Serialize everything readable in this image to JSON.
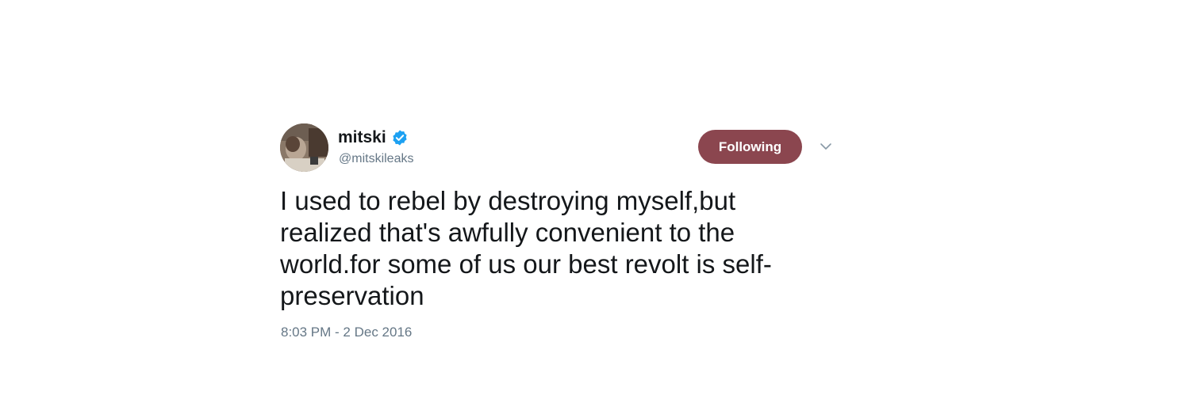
{
  "tweet": {
    "author": {
      "display_name": "mitski",
      "handle": "@mitskileaks",
      "verified": true,
      "avatar_icon": "profile-photo-avatar"
    },
    "follow_button_label": "Following",
    "menu_icon": "chevron-down-icon",
    "text": "I used to rebel by destroying myself,but\nrealized that's awfully convenient to the\nworld.for some of us our best revolt is self-\npreservation",
    "timestamp": "8:03 PM - 2 Dec 2016"
  },
  "colors": {
    "follow_button_bg": "#8b464f",
    "verified_badge": "#1da1f2",
    "secondary_text": "#657786",
    "primary_text": "#14171a"
  }
}
